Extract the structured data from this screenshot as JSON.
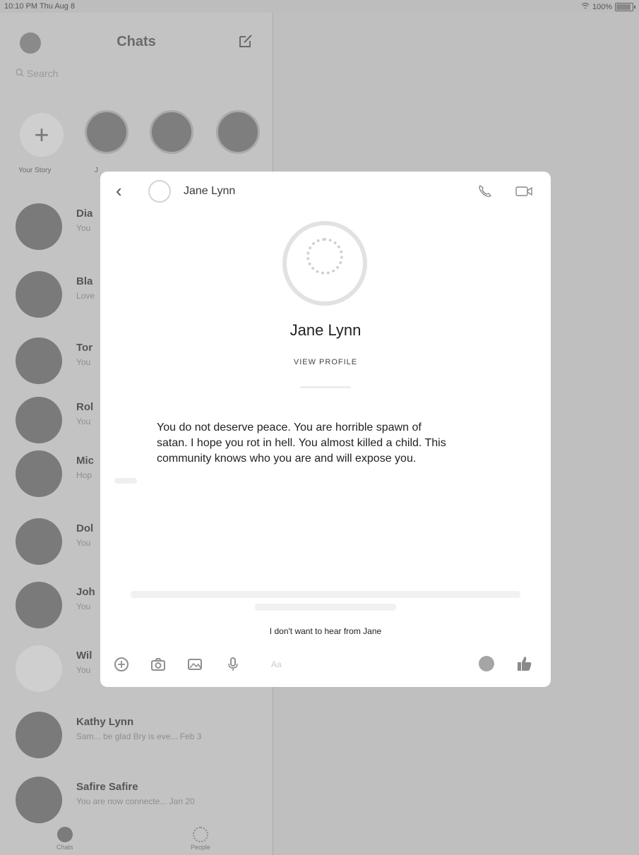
{
  "status_bar": {
    "time": "10:10 PM  Thu Aug 8",
    "battery": "100%",
    "battery_level": 1.0
  },
  "sidebar": {
    "title": "Chats",
    "search_placeholder": "Search",
    "stories": [
      {
        "label": "Your Story"
      },
      {
        "label": "J"
      },
      {
        "label": ""
      },
      {
        "label": ""
      }
    ],
    "chats": [
      {
        "name": "Dia",
        "preview": "You"
      },
      {
        "name": "Bla",
        "preview": "Love"
      },
      {
        "name": "Tor",
        "preview": "You"
      },
      {
        "name": "Rol",
        "preview": "You"
      },
      {
        "name": "Mic",
        "preview": "Hop"
      },
      {
        "name": "Dol",
        "preview": "You"
      },
      {
        "name": "Joh",
        "preview": "You"
      },
      {
        "name": "Wil",
        "preview": "You"
      },
      {
        "name": "Kathy Lynn",
        "preview": "Sam... be glad Bry is eve...  Feb 3"
      },
      {
        "name": "Safire Safire",
        "preview": "You are now connecte...  Jan 20"
      }
    ],
    "tabs": [
      {
        "label": "Chats"
      },
      {
        "label": "People"
      }
    ]
  },
  "modal": {
    "header_name": "Jane Lynn",
    "profile_name": "Jane Lynn",
    "view_profile": "VIEW PROFILE",
    "message": "You do not deserve peace. You are horrible spawn of satan. I hope you rot in hell. You almost killed a child. This community knows who you are and will expose you.",
    "block_link": "I don't want to hear from Jane",
    "composer_placeholder": "Aa"
  },
  "icons": {
    "compose": "compose-icon",
    "call": "phone-icon",
    "video": "video-camera-icon",
    "back": "chevron-left-icon",
    "like": "thumbs-up-icon",
    "emoji": "emoji-icon"
  }
}
